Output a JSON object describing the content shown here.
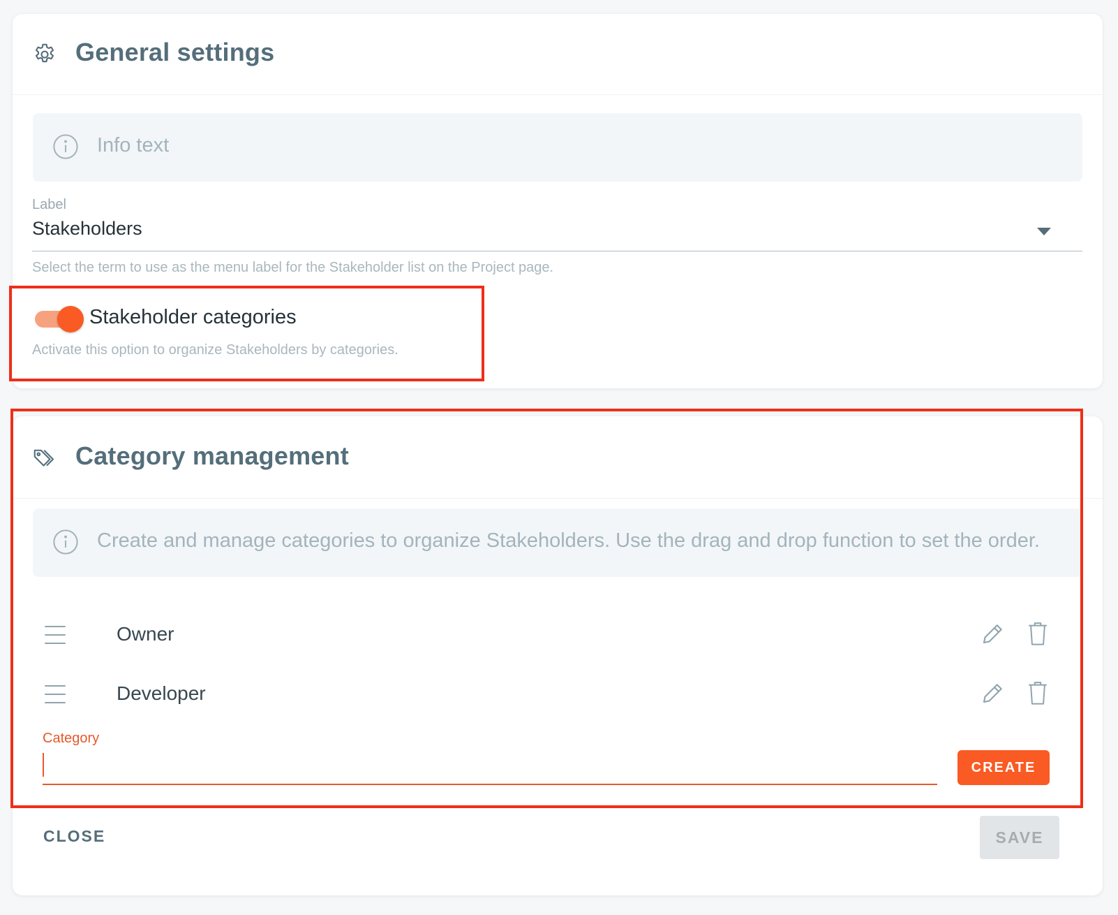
{
  "general": {
    "title": "General settings",
    "header_icon": "gear-icon",
    "info_text": "Info text",
    "label_caption": "Label",
    "label_value": "Stakeholders",
    "label_hint": "Select the term to use as the menu label for the Stakeholder list on the Project page.",
    "toggle": {
      "label": "Stakeholder categories",
      "on": true,
      "hint": "Activate this option to organize Stakeholders by categories."
    }
  },
  "category": {
    "title": "Category management",
    "header_icon": "tag-icon",
    "info_text": "Create and manage categories to organize Stakeholders. Use the drag and drop function to set the order.",
    "items": [
      {
        "name": "Owner"
      },
      {
        "name": "Developer"
      }
    ],
    "input_caption": "Category",
    "input_value": "",
    "create_label": "CREATE"
  },
  "footer": {
    "close_label": "CLOSE",
    "save_label": "SAVE"
  },
  "colors": {
    "accent": "#fa5a23",
    "highlight": "#ee2f19",
    "heading": "#546e7a"
  }
}
